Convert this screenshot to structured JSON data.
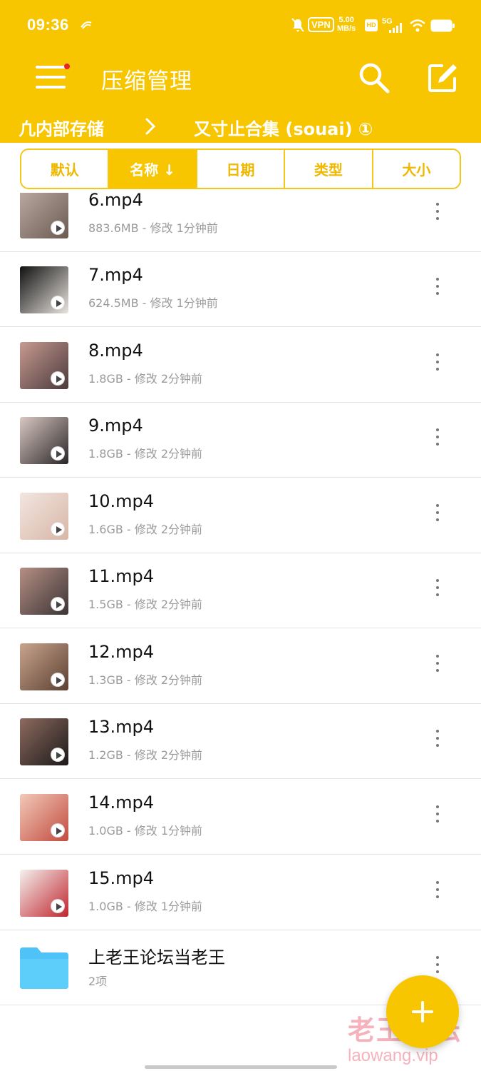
{
  "status_bar": {
    "time": "09:36",
    "vpn": "VPN",
    "speed_value": "5.00",
    "speed_unit": "MB/s",
    "hd": "HD",
    "network": "5G"
  },
  "app_bar": {
    "title": "压缩管理"
  },
  "breadcrumb": {
    "root": "凢内部存储",
    "current": "又寸止合集 (souai) ①"
  },
  "sort_tabs": [
    {
      "label": "默认",
      "active": false
    },
    {
      "label": "名称 ↓",
      "active": true
    },
    {
      "label": "日期",
      "active": false
    },
    {
      "label": "类型",
      "active": false
    },
    {
      "label": "大小",
      "active": false
    }
  ],
  "files": [
    {
      "name": "6.mp4",
      "meta": "883.6MB - 修改 1分钟前",
      "thumb_colors": [
        "#b9a9a0",
        "#6b5a52"
      ]
    },
    {
      "name": "7.mp4",
      "meta": "624.5MB - 修改 1分钟前",
      "thumb_colors": [
        "#111111",
        "#e8e4de"
      ]
    },
    {
      "name": "8.mp4",
      "meta": "1.8GB - 修改 2分钟前",
      "thumb_colors": [
        "#c79a90",
        "#4a3a3c"
      ]
    },
    {
      "name": "9.mp4",
      "meta": "1.8GB - 修改 2分钟前",
      "thumb_colors": [
        "#d9c8c2",
        "#2a2628"
      ]
    },
    {
      "name": "10.mp4",
      "meta": "1.6GB - 修改 2分钟前",
      "thumb_colors": [
        "#f1e6e0",
        "#d8b6a6"
      ]
    },
    {
      "name": "11.mp4",
      "meta": "1.5GB - 修改 2分钟前",
      "thumb_colors": [
        "#b58f83",
        "#3b3436"
      ]
    },
    {
      "name": "12.mp4",
      "meta": "1.3GB - 修改 2分钟前",
      "thumb_colors": [
        "#c9a48d",
        "#5b4032"
      ]
    },
    {
      "name": "13.mp4",
      "meta": "1.2GB - 修改 2分钟前",
      "thumb_colors": [
        "#8d6a5e",
        "#1c1a1a"
      ]
    },
    {
      "name": "14.mp4",
      "meta": "1.0GB - 修改 1分钟前",
      "thumb_colors": [
        "#f1c9b8",
        "#c24b3f"
      ]
    },
    {
      "name": "15.mp4",
      "meta": "1.0GB - 修改 1分钟前",
      "thumb_colors": [
        "#f4f1ee",
        "#c0262f"
      ]
    }
  ],
  "folder": {
    "name": "上老王论坛当老王",
    "meta": "2项"
  },
  "watermark": {
    "line1": "老王论坛",
    "line2": "laowang.vip"
  },
  "colors": {
    "accent": "#f8c600",
    "folder": "#4fc3f7",
    "menu_badge": "#e8262a"
  }
}
